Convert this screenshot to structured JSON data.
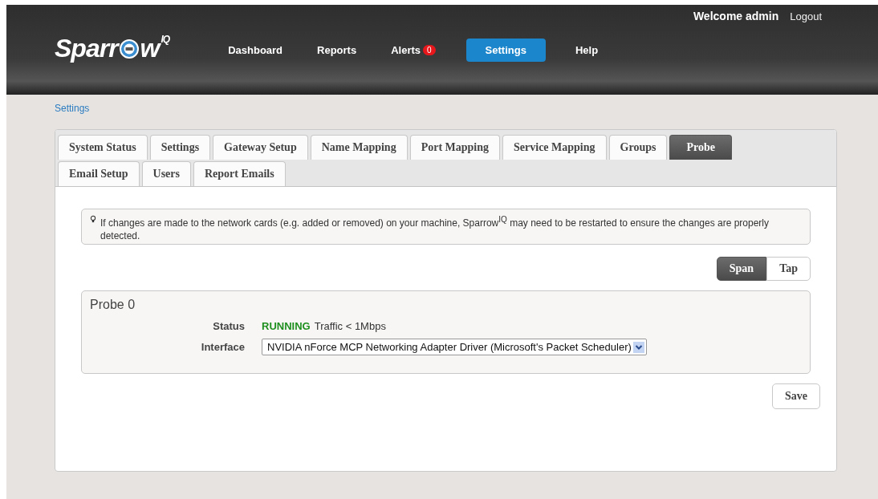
{
  "header": {
    "logo": {
      "before": "Sparr",
      "after": "w",
      "sup": "IQ"
    },
    "welcome": "Welcome admin",
    "logout": "Logout",
    "nav": [
      {
        "label": "Dashboard",
        "selected": false
      },
      {
        "label": "Reports",
        "selected": false
      },
      {
        "label": "Alerts",
        "selected": false,
        "badge": "0"
      },
      {
        "label": "Settings",
        "selected": true
      },
      {
        "label": "Help",
        "selected": false
      }
    ]
  },
  "breadcrumb": "Settings",
  "tabs": [
    [
      {
        "label": "System Status",
        "selected": false
      },
      {
        "label": "Settings",
        "selected": false
      },
      {
        "label": "Gateway Setup",
        "selected": false
      },
      {
        "label": "Name Mapping",
        "selected": false
      },
      {
        "label": "Port Mapping",
        "selected": false
      },
      {
        "label": "Service Mapping",
        "selected": false
      },
      {
        "label": "Groups",
        "selected": false
      },
      {
        "label": "Probe",
        "selected": true
      }
    ],
    [
      {
        "label": "Email Setup",
        "selected": false
      },
      {
        "label": "Users",
        "selected": false
      },
      {
        "label": "Report Emails",
        "selected": false
      }
    ]
  ],
  "notice": "If changes are made to the network cards (e.g. added or removed) on your machine, Sparrow$^{IQ}$ may need to be restarted to ensure the changes are properly detected.",
  "modes": [
    {
      "label": "Span",
      "selected": true
    },
    {
      "label": "Tap",
      "selected": false
    }
  ],
  "probe": {
    "title": "Probe 0",
    "status_label": "Status",
    "status_value": "RUNNING",
    "status_detail": "Traffic < 1Mbps",
    "interface_label": "Interface",
    "interface_value": "NVIDIA nForce MCP Networking Adapter Driver (Microsoft's Packet Scheduler)"
  },
  "save": "Save"
}
